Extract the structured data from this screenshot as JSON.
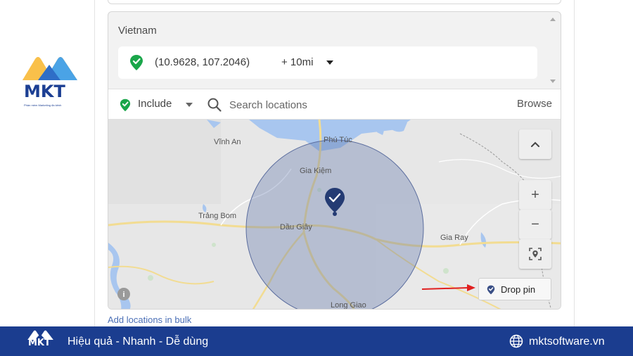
{
  "brand": {
    "name": "MKT",
    "tagline": "Phần mềm Marketing đa kênh",
    "colors": {
      "blue": "#1c3f93",
      "orange": "#f6a623",
      "light_blue": "#4aa3e6"
    }
  },
  "location_panel": {
    "country": "Vietnam",
    "selected_location": {
      "coordinates": "(10.9628, 107.2046)",
      "radius": "+ 10mi",
      "pin_icon": "green-check-pin-icon"
    },
    "include_label": "Include",
    "search_placeholder": "Search locations",
    "browse_label": "Browse",
    "add_bulk_label": "Add locations in bulk"
  },
  "map": {
    "places": {
      "vinh_an": "Vĩnh An",
      "phu_tuc": "Phú Túc",
      "gia_kiem": "Gia Kiệm",
      "trang_bom": "Trảng Bom",
      "dau_giay": "Dầu Giây",
      "gia_ray": "Gia Ray",
      "long_giao": "Long Giao"
    },
    "controls": {
      "collapse_icon": "chevron-up-icon",
      "zoom_in": "+",
      "zoom_out": "−",
      "locate_icon": "locate-icon"
    },
    "drop_pin_label": "Drop pin"
  },
  "footer": {
    "logo_text": "MKT",
    "slogan": "Hiệu quả - Nhanh - Dễ dùng",
    "website": "mktsoftware.vn",
    "bg_color": "#1b3d8f"
  }
}
